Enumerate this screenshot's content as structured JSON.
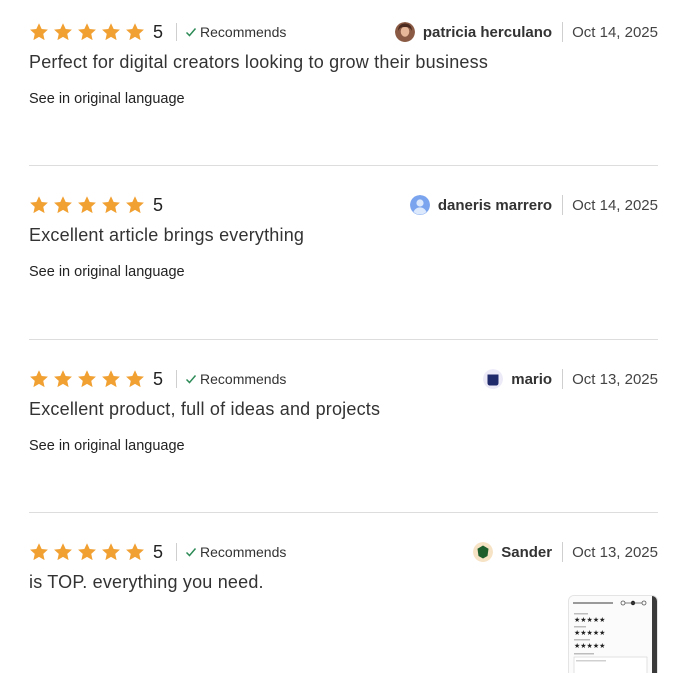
{
  "colors": {
    "star": "#f1a032",
    "check": "#2e8b57",
    "divider": "#dddddd"
  },
  "reviews": [
    {
      "rating": "5",
      "recommends": "Recommends",
      "author": "patricia herculano",
      "date": "Oct 14, 2025",
      "text": "Perfect for digital creators looking to grow their business",
      "translate_label": "See in original language"
    },
    {
      "rating": "5",
      "author": "daneris marrero",
      "date": "Oct 14, 2025",
      "text": "Excellent article brings everything",
      "translate_label": "See in original language"
    },
    {
      "rating": "5",
      "recommends": "Recommends",
      "author": "mario",
      "date": "Oct 13, 2025",
      "text": "Excellent product, full of ideas and projects",
      "translate_label": "See in original language"
    },
    {
      "rating": "5",
      "recommends": "Recommends",
      "author": "Sander",
      "date": "Oct 13, 2025",
      "text": "is TOP. everything you need.",
      "thumbnail_icon": "review-image-thumbnail"
    }
  ]
}
